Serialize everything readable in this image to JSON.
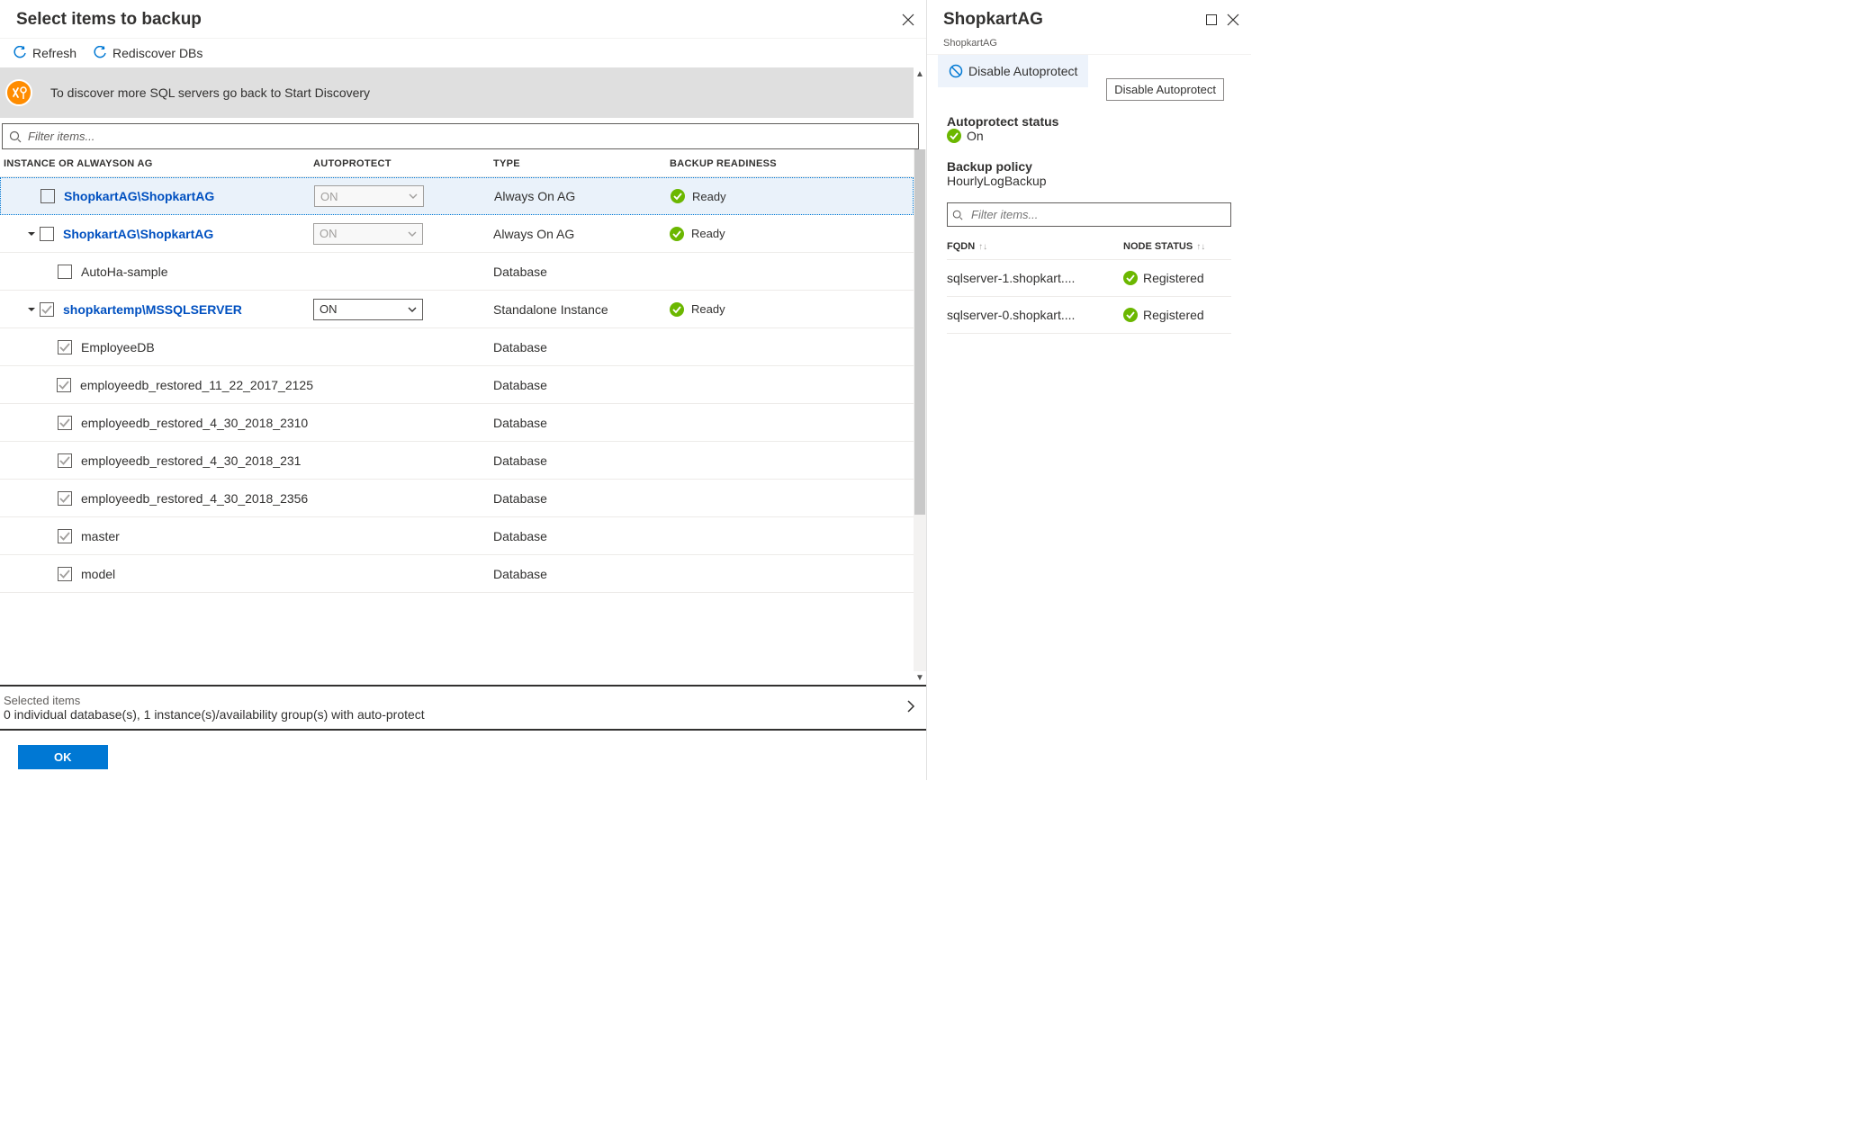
{
  "left": {
    "title": "Select items to backup",
    "toolbar": {
      "refresh": "Refresh",
      "rediscover": "Rediscover DBs"
    },
    "info": "To discover more SQL servers go back to Start Discovery",
    "filter_placeholder": "Filter items...",
    "columns": {
      "name": "INSTANCE OR ALWAYSON AG",
      "auto": "AUTOPROTECT",
      "type": "TYPE",
      "ready": "BACKUP READINESS"
    },
    "rows": [
      {
        "name": "ShopkartAG\\ShopkartAG",
        "link": true,
        "auto": "ON",
        "auto_disabled": true,
        "type": "Always On AG",
        "ready": "Ready",
        "indent": 1,
        "expand": "",
        "checked": "none",
        "selected": true
      },
      {
        "name": "ShopkartAG\\ShopkartAG",
        "link": true,
        "auto": "ON",
        "auto_disabled": true,
        "type": "Always On AG",
        "ready": "Ready",
        "indent": 1,
        "expand": "▼",
        "checked": "none"
      },
      {
        "name": "AutoHa-sample",
        "link": false,
        "auto": "",
        "type": "Database",
        "ready": "",
        "indent": 2,
        "expand": "",
        "checked": "none"
      },
      {
        "name": "shopkartemp\\MSSQLSERVER",
        "link": true,
        "auto": "ON",
        "auto_disabled": false,
        "type": "Standalone Instance",
        "ready": "Ready",
        "indent": 1,
        "expand": "▼",
        "checked": "grey"
      },
      {
        "name": "EmployeeDB",
        "link": false,
        "auto": "",
        "type": "Database",
        "ready": "",
        "indent": 2,
        "expand": "",
        "checked": "grey"
      },
      {
        "name": "employeedb_restored_11_22_2017_2125",
        "link": false,
        "auto": "",
        "type": "Database",
        "ready": "",
        "indent": 2,
        "expand": "",
        "checked": "grey"
      },
      {
        "name": "employeedb_restored_4_30_2018_2310",
        "link": false,
        "auto": "",
        "type": "Database",
        "ready": "",
        "indent": 2,
        "expand": "",
        "checked": "grey"
      },
      {
        "name": "employeedb_restored_4_30_2018_231",
        "link": false,
        "auto": "",
        "type": "Database",
        "ready": "",
        "indent": 2,
        "expand": "",
        "checked": "grey"
      },
      {
        "name": "employeedb_restored_4_30_2018_2356",
        "link": false,
        "auto": "",
        "type": "Database",
        "ready": "",
        "indent": 2,
        "expand": "",
        "checked": "grey"
      },
      {
        "name": "master",
        "link": false,
        "auto": "",
        "type": "Database",
        "ready": "",
        "indent": 2,
        "expand": "",
        "checked": "grey"
      },
      {
        "name": "model",
        "link": false,
        "auto": "",
        "type": "Database",
        "ready": "",
        "indent": 2,
        "expand": "",
        "checked": "grey"
      }
    ],
    "selected_title": "Selected items",
    "selected_sub": "0 individual database(s), 1 instance(s)/availability group(s) with auto-protect",
    "ok": "OK"
  },
  "right": {
    "title": "ShopkartAG",
    "subtitle": "ShopkartAG",
    "disable_btn": "Disable Autoprotect",
    "tooltip": "Disable Autoprotect",
    "status_label": "Autoprotect status",
    "status_val": "On",
    "policy_label": "Backup policy",
    "policy_val": "HourlyLogBackup",
    "filter_placeholder": "Filter items...",
    "node_cols": {
      "fqdn": "FQDN",
      "status": "NODE STATUS"
    },
    "nodes": [
      {
        "fqdn": "sqlserver-1.shopkart....",
        "status": "Registered"
      },
      {
        "fqdn": "sqlserver-0.shopkart....",
        "status": "Registered"
      }
    ]
  }
}
